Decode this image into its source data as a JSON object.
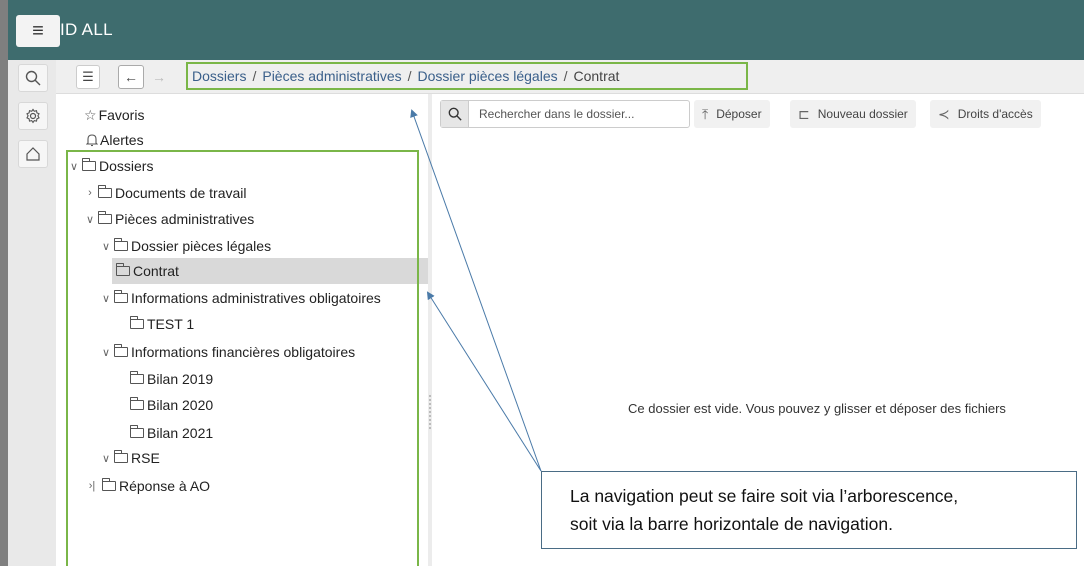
{
  "app": {
    "title": "ID ALL",
    "menu_icon": "hamburger-icon"
  },
  "rail": [
    {
      "icon": "search-icon"
    },
    {
      "icon": "gear-icon"
    },
    {
      "icon": "home-icon"
    }
  ],
  "nav": {
    "back_label": "←",
    "forward_label": "→",
    "toggle_label": "☰"
  },
  "breadcrumb": [
    {
      "label": "Dossiers"
    },
    {
      "label": "Pièces administratives"
    },
    {
      "label": "Dossier pièces légales"
    },
    {
      "label": "Contrat"
    }
  ],
  "breadcrumb_separator": "/",
  "tree": [
    {
      "label": "Favoris",
      "icon": "star-icon",
      "chevron": ""
    },
    {
      "label": "Alertes",
      "icon": "bell-icon",
      "chevron": ""
    },
    {
      "label": "Dossiers",
      "icon": "folder-icon",
      "chevron": "expanded"
    },
    {
      "label": "Documents de travail",
      "icon": "folder-icon",
      "chevron": "collapsed"
    },
    {
      "label": "Pièces administratives",
      "icon": "folder-icon",
      "chevron": "expanded"
    },
    {
      "label": "Dossier pièces légales",
      "icon": "folder-icon",
      "chevron": "expanded"
    },
    {
      "label": "Contrat",
      "icon": "folder-icon",
      "chevron": "",
      "selected": true
    },
    {
      "label": "Informations administratives obligatoires",
      "icon": "folder-icon",
      "chevron": "expanded"
    },
    {
      "label": "TEST 1",
      "icon": "folder-icon",
      "chevron": ""
    },
    {
      "label": "Informations financières obligatoires",
      "icon": "folder-icon",
      "chevron": "expanded"
    },
    {
      "label": "Bilan 2019",
      "icon": "folder-icon",
      "chevron": ""
    },
    {
      "label": "Bilan 2020",
      "icon": "folder-icon",
      "chevron": ""
    },
    {
      "label": "Bilan 2021",
      "icon": "folder-icon",
      "chevron": ""
    },
    {
      "label": "RSE",
      "icon": "folder-icon",
      "chevron": "expanded"
    },
    {
      "label": "Réponse à AO",
      "icon": "folder-icon",
      "chevron": "skip"
    }
  ],
  "toolbar": {
    "search_placeholder": "Rechercher dans le dossier...",
    "upload_label": "Déposer",
    "new_folder_label": "Nouveau dossier",
    "access_label": "Droits d'accès"
  },
  "empty_message": "Ce dossier est vide. Vous pouvez y glisser et déposer des fichiers",
  "callout": {
    "line1": "La navigation peut se faire soit via l’arborescence,",
    "line2": "soit via la barre horizontale de navigation."
  },
  "colors": {
    "topbar": "#3e6c6e",
    "highlight_box": "#7ab648",
    "arrow": "#4a7aa8",
    "selected_row": "#d9d9d9"
  }
}
